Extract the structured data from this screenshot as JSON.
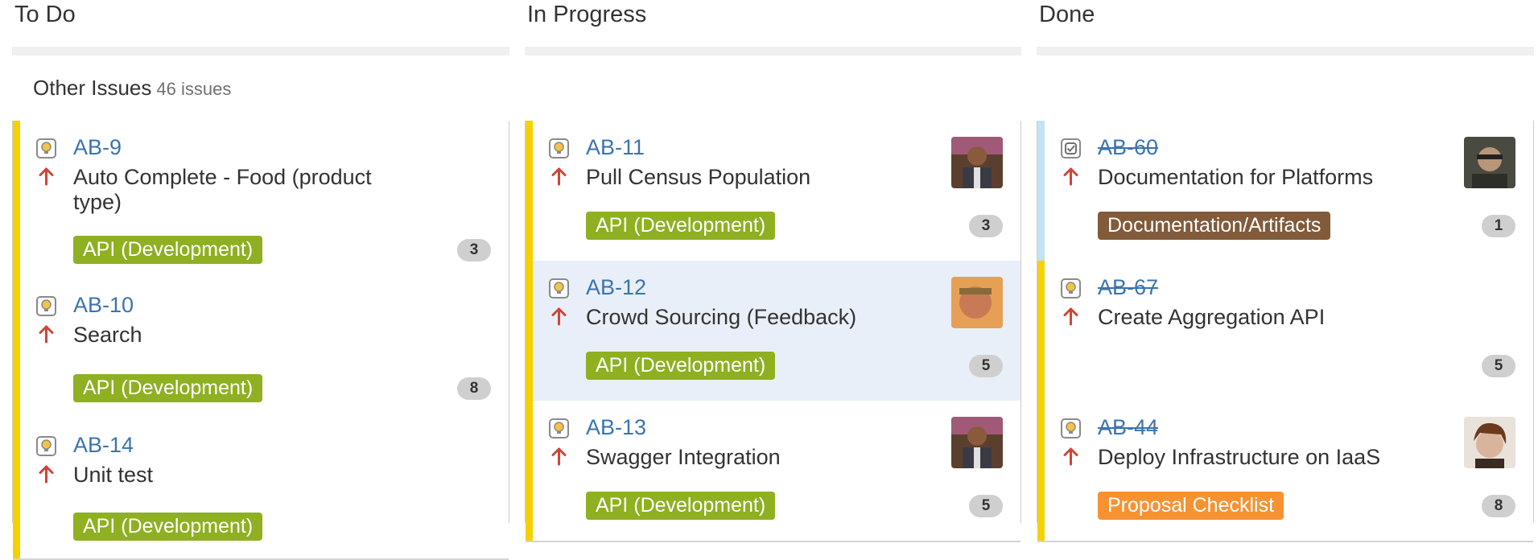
{
  "columns": {
    "todo": "To Do",
    "in_progress": "In Progress",
    "done": "Done"
  },
  "swimlane": {
    "title": "Other Issues",
    "count": "46 issues"
  },
  "colors": {
    "link": "#3b73af",
    "priority_high": "#d04437",
    "flag_yellow": "#f6d100",
    "flag_blue": "#c3e2f6",
    "epic_green": "#8eb021",
    "epic_brown": "#815b3a",
    "epic_orange": "#f79232",
    "selected_bg": "#e9eff8"
  },
  "cards": {
    "todo": [
      {
        "key": "AB-9",
        "summary": "Auto Complete - Food (product type)",
        "epic": "API (Development)",
        "points": "3",
        "type_icon": "idea-icon",
        "priority_icon": "priority-high-icon"
      },
      {
        "key": "AB-10",
        "summary": "Search",
        "epic": "API (Development)",
        "points": "8",
        "type_icon": "idea-icon",
        "priority_icon": "priority-high-icon"
      },
      {
        "key": "AB-14",
        "summary": "Unit test",
        "epic": "API (Development)",
        "points": "",
        "type_icon": "idea-icon",
        "priority_icon": "priority-high-icon"
      }
    ],
    "in_progress": [
      {
        "key": "AB-11",
        "summary": "Pull Census Population",
        "epic": "API (Development)",
        "points": "3",
        "type_icon": "idea-icon",
        "priority_icon": "priority-high-icon",
        "avatar": "user-avatar"
      },
      {
        "key": "AB-12",
        "summary": "Crowd Sourcing (Feedback)",
        "epic": "API (Development)",
        "points": "5",
        "type_icon": "idea-icon",
        "priority_icon": "priority-high-icon",
        "avatar": "user-avatar",
        "selected": true
      },
      {
        "key": "AB-13",
        "summary": "Swagger Integration",
        "epic": "API (Development)",
        "points": "5",
        "type_icon": "idea-icon",
        "priority_icon": "priority-high-icon",
        "avatar": "user-avatar"
      }
    ],
    "done": [
      {
        "key": "AB-60",
        "summary": "Documentation for Platforms",
        "epic": "Documentation/Artifacts",
        "points": "1",
        "type_icon": "task-icon",
        "priority_icon": "priority-high-icon",
        "avatar": "user-avatar"
      },
      {
        "key": "AB-67",
        "summary": "Create Aggregation API",
        "epic": "",
        "points": "5",
        "type_icon": "idea-icon",
        "priority_icon": "priority-high-icon"
      },
      {
        "key": "AB-44",
        "summary": "Deploy Infrastructure on IaaS",
        "epic": "Proposal Checklist",
        "points": "8",
        "type_icon": "idea-icon",
        "priority_icon": "priority-high-icon",
        "avatar": "user-avatar"
      }
    ]
  }
}
